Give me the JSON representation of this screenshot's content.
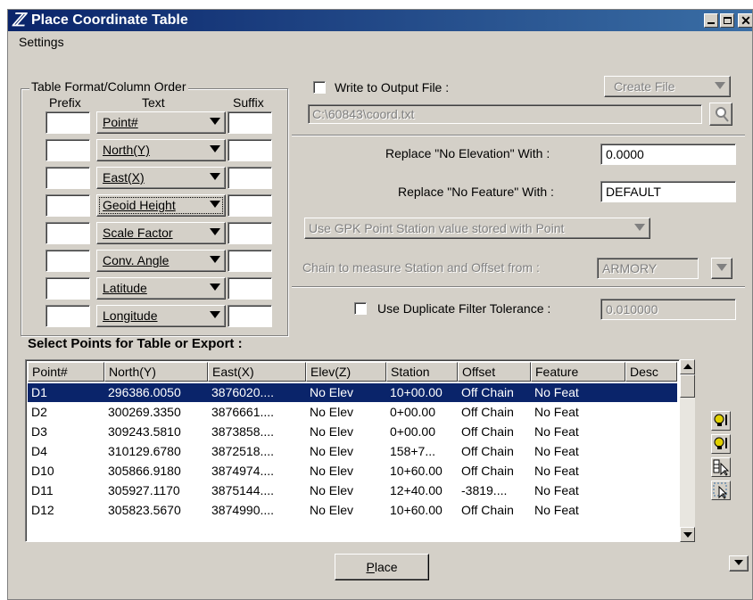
{
  "window": {
    "title": "Place Coordinate Table"
  },
  "menu": {
    "settings": "Settings"
  },
  "format_group": {
    "title": "Table Format/Column Order",
    "headers": {
      "prefix": "Prefix",
      "text": "Text",
      "suffix": "Suffix"
    },
    "rows": [
      {
        "text": "Point#",
        "prefix": "",
        "suffix": ""
      },
      {
        "text": "North(Y)",
        "prefix": "",
        "suffix": ""
      },
      {
        "text": "East(X)",
        "prefix": "",
        "suffix": ""
      },
      {
        "text": "Geoid Height",
        "prefix": "",
        "suffix": ""
      },
      {
        "text": "Scale Factor",
        "prefix": "",
        "suffix": ""
      },
      {
        "text": "Conv. Angle",
        "prefix": "",
        "suffix": ""
      },
      {
        "text": "Latitude",
        "prefix": "",
        "suffix": ""
      },
      {
        "text": "Longitude",
        "prefix": "",
        "suffix": ""
      }
    ]
  },
  "output": {
    "write_label": "Write to Output File :",
    "write_checked": false,
    "create_file": "Create File",
    "path": "C:\\60843\\coord.txt"
  },
  "replace": {
    "no_elev_label": "Replace \"No Elevation\" With :",
    "no_elev_value": "0.0000",
    "no_feat_label": "Replace \"No Feature\" With :",
    "no_feat_value": "DEFAULT"
  },
  "station": {
    "use_gpk": "Use GPK Point Station value stored with Point",
    "chain_label": "Chain to measure Station and Offset from :",
    "chain_value": "ARMORY"
  },
  "duplicate": {
    "label": "Use Duplicate Filter Tolerance :",
    "checked": false,
    "value": "0.010000"
  },
  "points": {
    "title": "Select Points for Table or Export :",
    "columns": [
      "Point#",
      "North(Y)",
      "East(X)",
      "Elev(Z)",
      "Station",
      "Offset",
      "Feature",
      "Desc"
    ],
    "rows": [
      [
        "D1",
        "296386.0050",
        "3876020....",
        "No Elev",
        "10+00.00",
        "Off Chain",
        "No Feat",
        ""
      ],
      [
        "D2",
        "300269.3350",
        "3876661....",
        "No Elev",
        "0+00.00",
        "Off Chain",
        "No Feat",
        ""
      ],
      [
        "D3",
        "309243.5810",
        "3873858....",
        "No Elev",
        "0+00.00",
        "Off Chain",
        "No Feat",
        ""
      ],
      [
        "D4",
        "310129.6780",
        "3872518....",
        "No Elev",
        "158+7...",
        "Off Chain",
        "No Feat",
        ""
      ],
      [
        "D10",
        "305866.9180",
        "3874974....",
        "No Elev",
        "10+60.00",
        "Off Chain",
        "No Feat",
        ""
      ],
      [
        "D11",
        "305927.1170",
        "3875144....",
        "No Elev",
        "12+40.00",
        "-3819....",
        "No Feat",
        ""
      ],
      [
        "D12",
        "305823.5670",
        "3874990....",
        "No Elev",
        "10+60.00",
        "Off Chain",
        "No Feat",
        ""
      ]
    ],
    "selected_row": 0
  },
  "place_button": "Place",
  "colors": {
    "titlebar": "#0a246a",
    "face": "#d4d0c8",
    "selection": "#0a246a",
    "bulb": "#e0d000"
  }
}
